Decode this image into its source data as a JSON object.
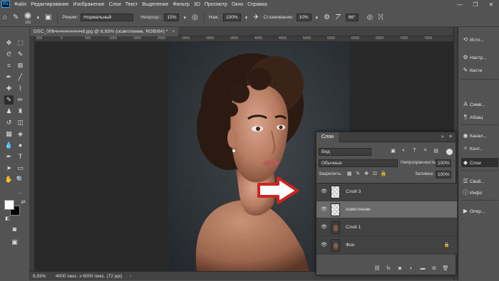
{
  "app": {
    "logo": "Ps"
  },
  "menubar": {
    "items": [
      "Файл",
      "Редактирование",
      "Изображение",
      "Слои",
      "Текст",
      "Выделение",
      "Фильтр",
      "3D",
      "Просмотр",
      "Окно",
      "Справка"
    ],
    "window_controls": [
      "—",
      "❐",
      "✕"
    ]
  },
  "options_bar": {
    "brush_size": "199",
    "mode_label": "Режим:",
    "mode_value": "Нормальный",
    "opacity_label": "Непрозр.:",
    "opacity_value": "15%",
    "pressure_label": "Наж.:",
    "pressure_value": "100%",
    "smoothing_label": "Сглаживание:",
    "smoothing_value": "10%",
    "angle_value": "66°"
  },
  "document": {
    "tab_title": "DSC_006ччччччччччч8.jpg @ 8,93% (осветление, RGB/8#) *",
    "tab_close": "×",
    "ruler_marks": [
      "500",
      "0",
      "500",
      "1000",
      "1500",
      "2000",
      "2500",
      "3000",
      "3500",
      "4000",
      "4500",
      "5000",
      "5500",
      "6000",
      "6500",
      "7000",
      "7500"
    ]
  },
  "status": {
    "zoom": "8,93%",
    "info": "4000 пикс. x 6000 пикс. (72 ppi)",
    "arrow": "›"
  },
  "right_dock": {
    "items": [
      {
        "icon": "history-icon",
        "glyph": "⟲",
        "label": "Исто..."
      },
      {
        "icon": "sliders-icon",
        "glyph": "⚙",
        "label": "Настр..."
      },
      {
        "icon": "brushes-icon",
        "glyph": "✎",
        "label": "Кисти"
      },
      {
        "icon": "character-icon",
        "glyph": "A",
        "label": "Симв..."
      },
      {
        "icon": "paragraph-icon",
        "glyph": "¶",
        "label": "Абзац"
      },
      {
        "icon": "channels-icon",
        "glyph": "◉",
        "label": "Канал..."
      },
      {
        "icon": "paths-icon",
        "glyph": "✧",
        "label": "Конт..."
      },
      {
        "icon": "layers-icon",
        "glyph": "◆",
        "label": "Слои"
      },
      {
        "icon": "properties-icon",
        "glyph": "☰",
        "label": "Свой..."
      },
      {
        "icon": "info-icon",
        "glyph": "ⓘ",
        "label": "Инфо"
      },
      {
        "icon": "actions-icon",
        "glyph": "▶",
        "label": "Опер..."
      }
    ]
  },
  "layers_panel": {
    "tab_label": "Слои",
    "collapse": "»",
    "menu": "≡",
    "filter_value": "Вид",
    "blend_mode": "Обычные",
    "opacity_label": "Непрозрачность:",
    "opacity_value": "100%",
    "lock_label": "Закрепить:",
    "fill_label": "Заливка:",
    "fill_value": "100%",
    "layers": [
      {
        "name": "Слой 3",
        "thumb": "transparent",
        "selected": false,
        "locked": false
      },
      {
        "name": "осветление",
        "thumb": "transparent",
        "selected": true,
        "locked": false
      },
      {
        "name": "Слой 1",
        "thumb": "image",
        "selected": false,
        "locked": false
      },
      {
        "name": "Фон",
        "thumb": "image",
        "selected": false,
        "locked": true
      }
    ]
  },
  "colors": {
    "accent": "#31a8ff",
    "background": "#535353",
    "canvas": "#292929",
    "arrow": "#c8261e"
  }
}
